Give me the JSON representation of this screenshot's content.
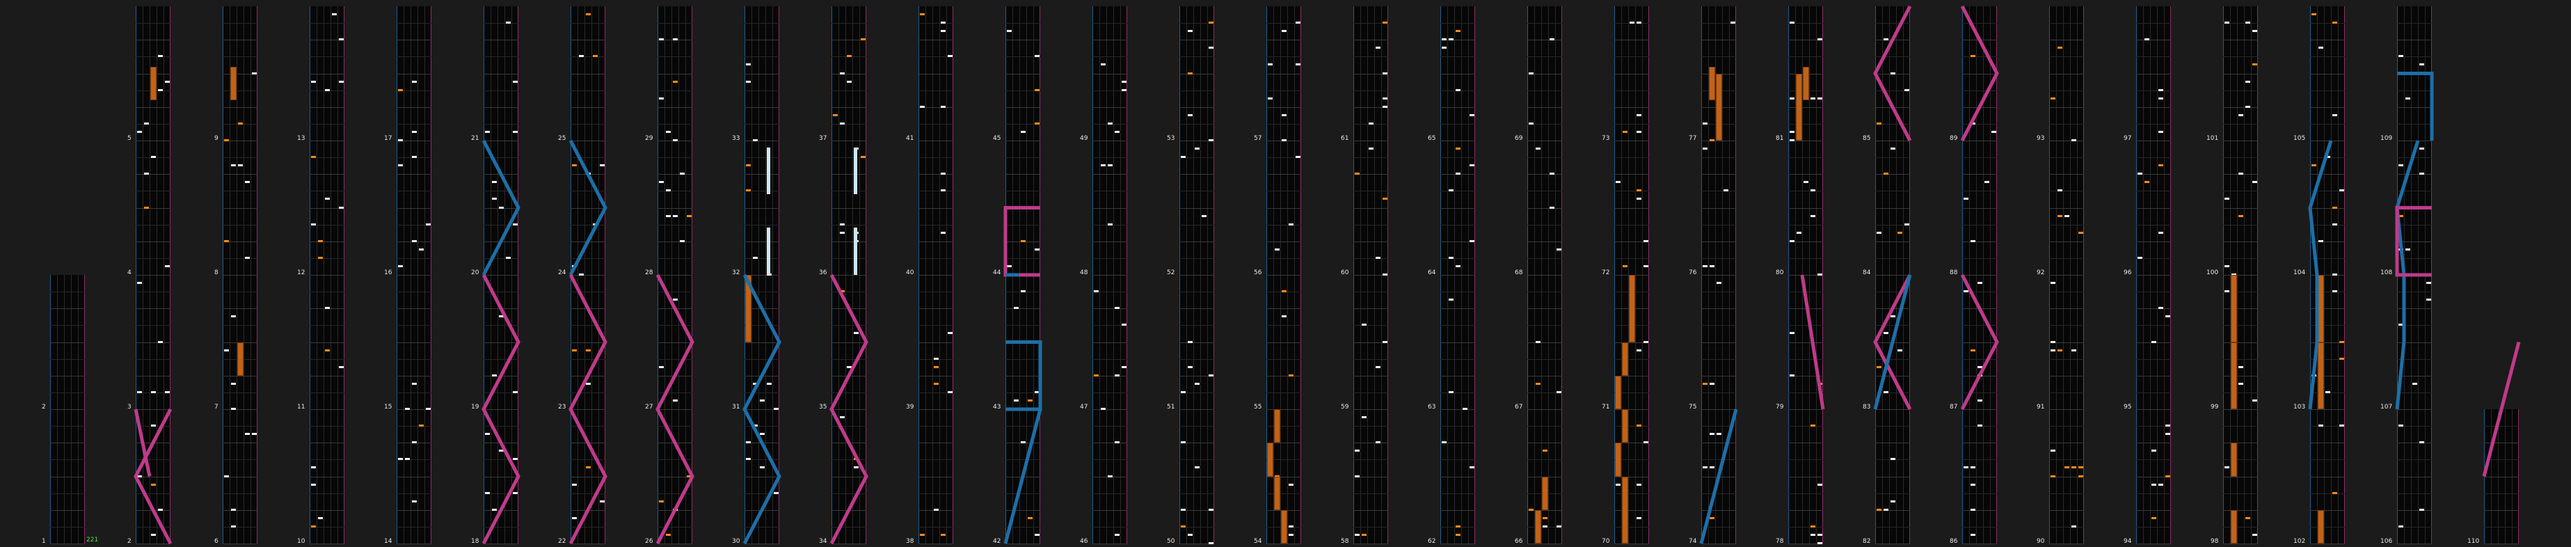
{
  "chart_view": {
    "type": "note-chart-viewer",
    "total_combo": "221",
    "colors": {
      "background": "#1b1b1b",
      "column": "#070707",
      "left_boundary": "#1f5f8c",
      "right_boundary": "#8c2f67",
      "normal_note": "#f2f2f2",
      "accent_note": "#ff8a1c",
      "hold_note": "#c26317",
      "pink_slider": "#c03a8a",
      "blue_slider": "#1d6fa8",
      "long_note": "#cfe7f2",
      "combo_text": "#56e040"
    },
    "measure_number_labels": [
      "1",
      "2",
      "3",
      "4",
      "5",
      "6",
      "7",
      "8",
      "9",
      "10",
      "11",
      "12",
      "13",
      "14",
      "15",
      "16",
      "17",
      "18",
      "19",
      "20",
      "21",
      "22",
      "23",
      "24",
      "25",
      "26",
      "27",
      "28",
      "29",
      "30",
      "31",
      "32",
      "33",
      "34",
      "35",
      "36",
      "37",
      "38",
      "39",
      "40",
      "41",
      "42",
      "43",
      "44",
      "45",
      "46",
      "47",
      "48",
      "49",
      "50",
      "51",
      "52",
      "53",
      "54",
      "55",
      "56",
      "57",
      "58",
      "59",
      "60",
      "61",
      "62",
      "63",
      "64",
      "65",
      "66",
      "67",
      "68",
      "69",
      "70",
      "71",
      "72",
      "73",
      "74",
      "75",
      "76",
      "77",
      "78",
      "79",
      "80",
      "81",
      "82",
      "83",
      "84",
      "85",
      "86",
      "87",
      "88",
      "89",
      "90",
      "91",
      "92",
      "93",
      "94",
      "95",
      "96",
      "97",
      "98",
      "99",
      "100",
      "101",
      "102",
      "103",
      "104",
      "105",
      "106",
      "107",
      "108",
      "109",
      "110"
    ]
  }
}
